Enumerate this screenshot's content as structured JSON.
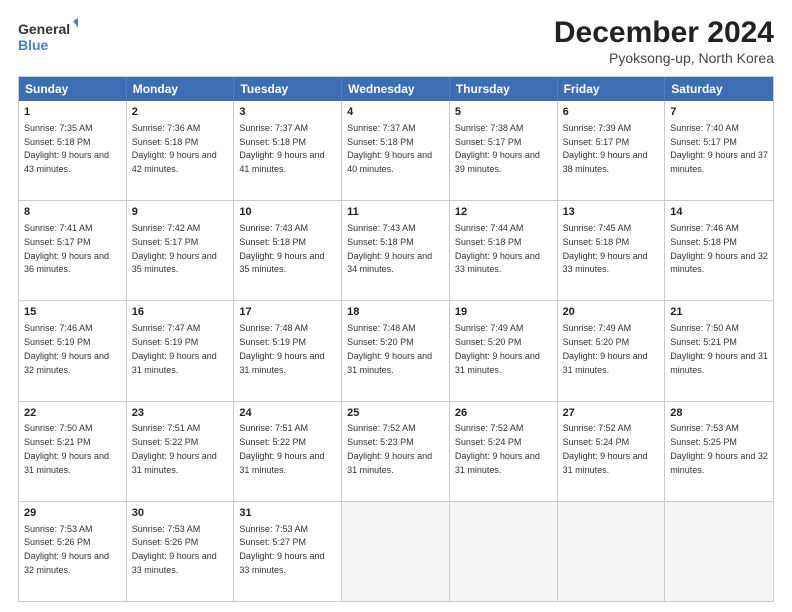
{
  "logo": {
    "line1": "General",
    "line2": "Blue"
  },
  "title": "December 2024",
  "subtitle": "Pyoksong-up, North Korea",
  "days": [
    "Sunday",
    "Monday",
    "Tuesday",
    "Wednesday",
    "Thursday",
    "Friday",
    "Saturday"
  ],
  "rows": [
    [
      {
        "num": "1",
        "sunrise": "7:35 AM",
        "sunset": "5:18 PM",
        "daylight": "9 hours and 43 minutes."
      },
      {
        "num": "2",
        "sunrise": "7:36 AM",
        "sunset": "5:18 PM",
        "daylight": "9 hours and 42 minutes."
      },
      {
        "num": "3",
        "sunrise": "7:37 AM",
        "sunset": "5:18 PM",
        "daylight": "9 hours and 41 minutes."
      },
      {
        "num": "4",
        "sunrise": "7:37 AM",
        "sunset": "5:18 PM",
        "daylight": "9 hours and 40 minutes."
      },
      {
        "num": "5",
        "sunrise": "7:38 AM",
        "sunset": "5:17 PM",
        "daylight": "9 hours and 39 minutes."
      },
      {
        "num": "6",
        "sunrise": "7:39 AM",
        "sunset": "5:17 PM",
        "daylight": "9 hours and 38 minutes."
      },
      {
        "num": "7",
        "sunrise": "7:40 AM",
        "sunset": "5:17 PM",
        "daylight": "9 hours and 37 minutes."
      }
    ],
    [
      {
        "num": "8",
        "sunrise": "7:41 AM",
        "sunset": "5:17 PM",
        "daylight": "9 hours and 36 minutes."
      },
      {
        "num": "9",
        "sunrise": "7:42 AM",
        "sunset": "5:17 PM",
        "daylight": "9 hours and 35 minutes."
      },
      {
        "num": "10",
        "sunrise": "7:43 AM",
        "sunset": "5:18 PM",
        "daylight": "9 hours and 35 minutes."
      },
      {
        "num": "11",
        "sunrise": "7:43 AM",
        "sunset": "5:18 PM",
        "daylight": "9 hours and 34 minutes."
      },
      {
        "num": "12",
        "sunrise": "7:44 AM",
        "sunset": "5:18 PM",
        "daylight": "9 hours and 33 minutes."
      },
      {
        "num": "13",
        "sunrise": "7:45 AM",
        "sunset": "5:18 PM",
        "daylight": "9 hours and 33 minutes."
      },
      {
        "num": "14",
        "sunrise": "7:46 AM",
        "sunset": "5:18 PM",
        "daylight": "9 hours and 32 minutes."
      }
    ],
    [
      {
        "num": "15",
        "sunrise": "7:46 AM",
        "sunset": "5:19 PM",
        "daylight": "9 hours and 32 minutes."
      },
      {
        "num": "16",
        "sunrise": "7:47 AM",
        "sunset": "5:19 PM",
        "daylight": "9 hours and 31 minutes."
      },
      {
        "num": "17",
        "sunrise": "7:48 AM",
        "sunset": "5:19 PM",
        "daylight": "9 hours and 31 minutes."
      },
      {
        "num": "18",
        "sunrise": "7:48 AM",
        "sunset": "5:20 PM",
        "daylight": "9 hours and 31 minutes."
      },
      {
        "num": "19",
        "sunrise": "7:49 AM",
        "sunset": "5:20 PM",
        "daylight": "9 hours and 31 minutes."
      },
      {
        "num": "20",
        "sunrise": "7:49 AM",
        "sunset": "5:20 PM",
        "daylight": "9 hours and 31 minutes."
      },
      {
        "num": "21",
        "sunrise": "7:50 AM",
        "sunset": "5:21 PM",
        "daylight": "9 hours and 31 minutes."
      }
    ],
    [
      {
        "num": "22",
        "sunrise": "7:50 AM",
        "sunset": "5:21 PM",
        "daylight": "9 hours and 31 minutes."
      },
      {
        "num": "23",
        "sunrise": "7:51 AM",
        "sunset": "5:22 PM",
        "daylight": "9 hours and 31 minutes."
      },
      {
        "num": "24",
        "sunrise": "7:51 AM",
        "sunset": "5:22 PM",
        "daylight": "9 hours and 31 minutes."
      },
      {
        "num": "25",
        "sunrise": "7:52 AM",
        "sunset": "5:23 PM",
        "daylight": "9 hours and 31 minutes."
      },
      {
        "num": "26",
        "sunrise": "7:52 AM",
        "sunset": "5:24 PM",
        "daylight": "9 hours and 31 minutes."
      },
      {
        "num": "27",
        "sunrise": "7:52 AM",
        "sunset": "5:24 PM",
        "daylight": "9 hours and 31 minutes."
      },
      {
        "num": "28",
        "sunrise": "7:53 AM",
        "sunset": "5:25 PM",
        "daylight": "9 hours and 32 minutes."
      }
    ],
    [
      {
        "num": "29",
        "sunrise": "7:53 AM",
        "sunset": "5:26 PM",
        "daylight": "9 hours and 32 minutes."
      },
      {
        "num": "30",
        "sunrise": "7:53 AM",
        "sunset": "5:26 PM",
        "daylight": "9 hours and 33 minutes."
      },
      {
        "num": "31",
        "sunrise": "7:53 AM",
        "sunset": "5:27 PM",
        "daylight": "9 hours and 33 minutes."
      },
      null,
      null,
      null,
      null
    ]
  ]
}
